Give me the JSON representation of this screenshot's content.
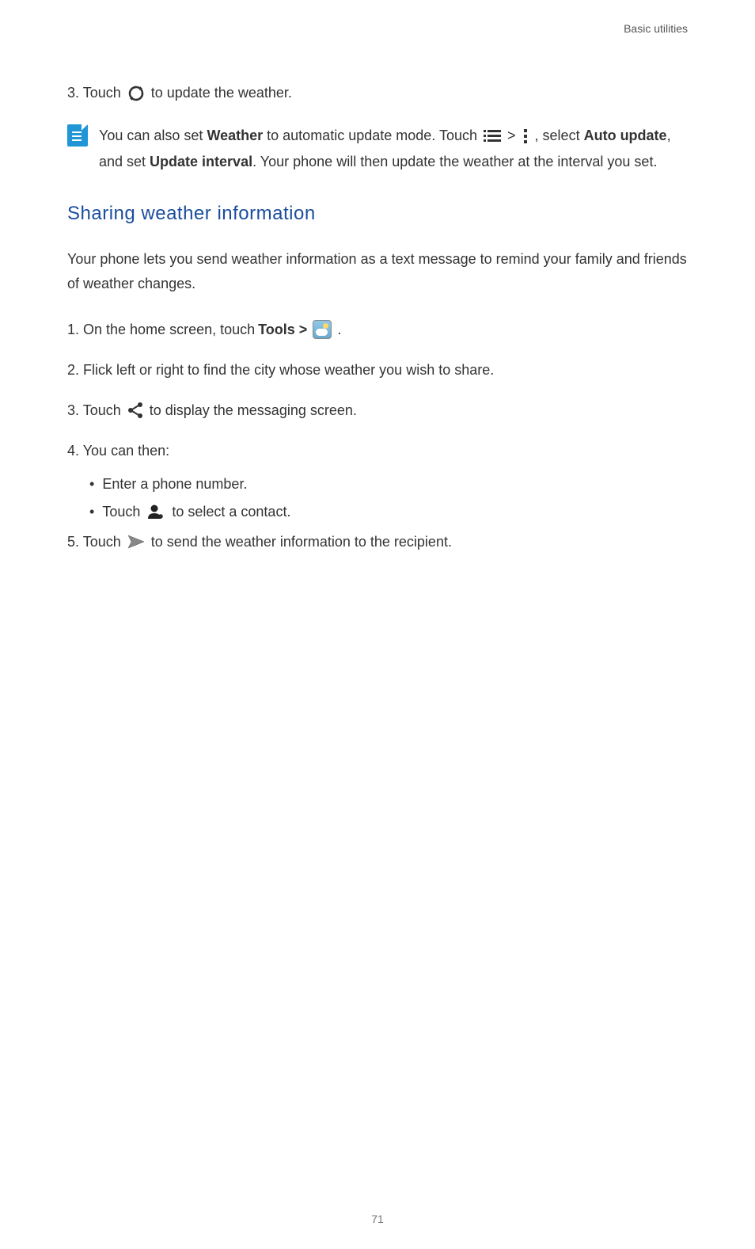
{
  "header": {
    "chapter": "Basic utilities"
  },
  "step3_update": {
    "prefix": "3. Touch ",
    "suffix": " to update the weather."
  },
  "note": {
    "part1": "You can also set ",
    "bold1": "Weather",
    "part2": " to automatic update mode. Touch ",
    "gt": " > ",
    "comma": " ,",
    "part3": "select ",
    "bold2": "Auto update",
    "part4": ", and set ",
    "bold3": "Update interval",
    "part5": ". Your phone will then update the weather at the interval you set."
  },
  "section": {
    "heading": "Sharing weather information",
    "intro": "Your phone lets you send weather information as a text message to remind your family and friends of weather changes."
  },
  "steps": {
    "s1_prefix": "1. On the home screen, touch ",
    "s1_bold": "Tools > ",
    "s1_suffix": " .",
    "s2": "2. Flick left or right to find the city whose weather you wish to share.",
    "s3_prefix": "3. Touch ",
    "s3_suffix": " to display the messaging screen.",
    "s4": "4. You can then:",
    "b1": "Enter a phone number.",
    "b2_prefix": "Touch ",
    "b2_suffix": " to select a contact.",
    "s5_prefix": "5. Touch ",
    "s5_suffix": " to send the weather information to the recipient."
  },
  "page_number": "71"
}
